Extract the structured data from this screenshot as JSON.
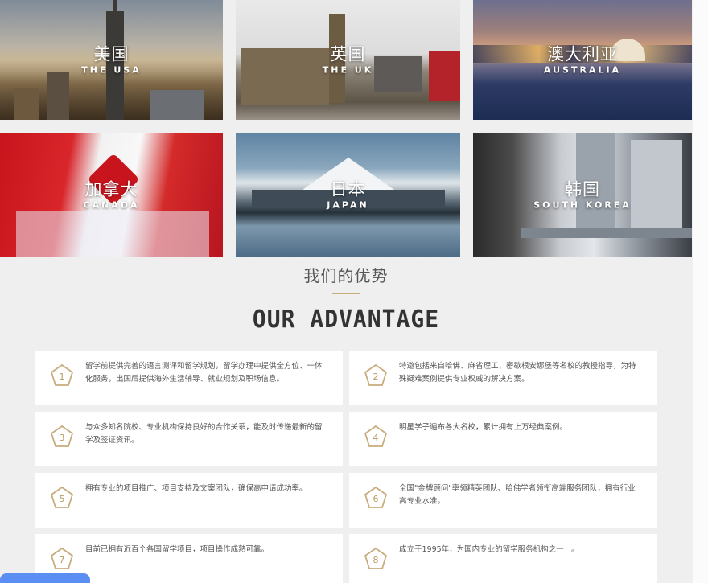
{
  "countries": [
    {
      "cn": "美国",
      "en": "THE USA"
    },
    {
      "cn": "英国",
      "en": "THE UK"
    },
    {
      "cn": "澳大利亚",
      "en": "AUSTRALIA"
    },
    {
      "cn": "加拿大",
      "en": "CANADA"
    },
    {
      "cn": "日本",
      "en": "JAPAN"
    },
    {
      "cn": "韩国",
      "en": "SOUTH KOREA"
    }
  ],
  "advantage": {
    "title_cn": "我们的优势",
    "title_en": "OUR ADVANTAGE",
    "accent_color": "#c7ad7d",
    "items": [
      {
        "num": "1",
        "text": "留学前提供完善的语言测评和留学规划，留学办理中提供全方位、一体化服务，出国后提供海外生活辅导、就业规划及职场信息。"
      },
      {
        "num": "2",
        "text": "特邀包括来自哈佛、麻省理工、密歇根安娜堡等名校的教授指导，为特殊疑难案例提供专业权威的解决方案。"
      },
      {
        "num": "3",
        "text": "与众多知名院校、专业机构保持良好的合作关系，能及时传递最新的留学及签证资讯。"
      },
      {
        "num": "4",
        "text": "明星学子遍布各大名校，累计拥有上万经典案例。"
      },
      {
        "num": "5",
        "text": "拥有专业的项目推广、项目支持及文案团队，确保高申请成功率。"
      },
      {
        "num": "6",
        "text": "全国\"金牌顾问\"率领精英团队、哈佛学者领衔高端服务团队，拥有行业高专业水准。"
      },
      {
        "num": "7",
        "text": "目前已拥有近百个各国留学项目，项目操作成熟可靠。"
      },
      {
        "num": "8",
        "text": "成立于1995年，为国内专业的留学服务机构之一　。"
      }
    ]
  }
}
